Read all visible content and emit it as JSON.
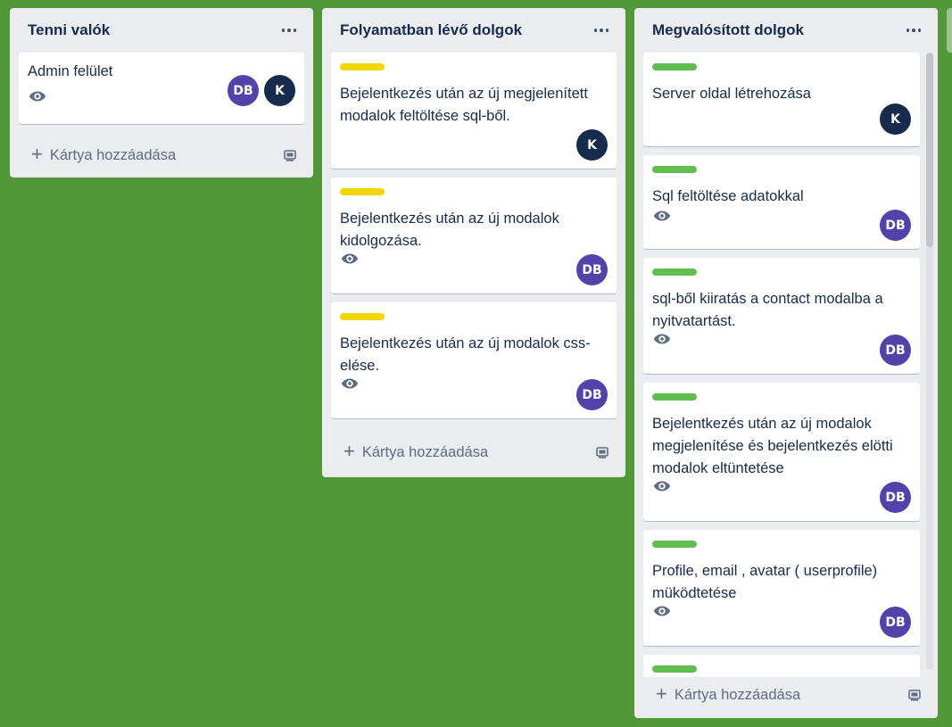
{
  "colors": {
    "board_bg": "#519839",
    "label_yellow": "#f2d600",
    "label_green": "#61bd4f",
    "avatar_db": "#5243aa",
    "avatar_k": "#172b4d"
  },
  "lists": [
    {
      "title": "Tenni valók",
      "add_label": "Kártya hozzáadása",
      "cards": [
        {
          "title": "Admin felület",
          "watching": true,
          "members": [
            "DB",
            "K"
          ]
        }
      ]
    },
    {
      "title": "Folyamatban lévő dolgok",
      "add_label": "Kártya hozzáadása",
      "cards": [
        {
          "label": "yellow",
          "title": "Bejelentkezés után az új megjelenített modalok feltöltése sql-ből.",
          "watching": false,
          "members": [
            "K"
          ]
        },
        {
          "label": "yellow",
          "title": "Bejelentkezés után az új modalok kidolgozása.",
          "watching": true,
          "members": [
            "DB"
          ]
        },
        {
          "label": "yellow",
          "title": "Bejelentkezés után az új modalok css-elése.",
          "watching": true,
          "members": [
            "DB"
          ]
        }
      ]
    },
    {
      "title": "Megvalósított dolgok",
      "add_label": "Kártya hozzáadása",
      "cards": [
        {
          "label": "green",
          "title": "Server oldal létrehozása",
          "watching": false,
          "members": [
            "K"
          ]
        },
        {
          "label": "green",
          "title": "Sql feltöltése adatokkal",
          "watching": true,
          "members": [
            "DB"
          ]
        },
        {
          "label": "green",
          "title": "sql-ből kiiratás a contact modalba a nyitvatartást.",
          "watching": true,
          "members": [
            "DB"
          ]
        },
        {
          "label": "green",
          "title": "Bejelentkezés után az új modalok megjelenítése és bejelentkezés elötti modalok eltüntetése",
          "watching": true,
          "members": [
            "DB"
          ]
        },
        {
          "label": "green",
          "title": "Profile, email , avatar ( userprofile) müködtetése",
          "watching": true,
          "members": [
            "DB"
          ]
        },
        {
          "label": "green",
          "title": "",
          "watching": false,
          "members": []
        }
      ]
    }
  ]
}
